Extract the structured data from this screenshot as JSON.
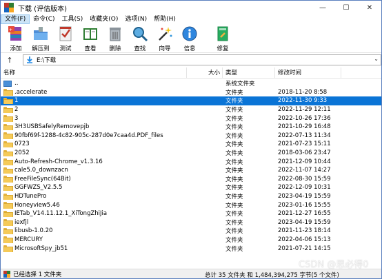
{
  "window": {
    "title": "下载 (评估版本)",
    "controls": {
      "minimize": "—",
      "maximize": "☐",
      "close": "✕"
    }
  },
  "menu": [
    {
      "label": "文件(F)",
      "active": true
    },
    {
      "label": "命令(C)"
    },
    {
      "label": "工具(S)"
    },
    {
      "label": "收藏夹(O)"
    },
    {
      "label": "选项(N)"
    },
    {
      "label": "帮助(H)"
    }
  ],
  "toolbar": [
    {
      "label": "添加",
      "icon": "add-icon"
    },
    {
      "label": "解压到",
      "icon": "extract-icon"
    },
    {
      "label": "测试",
      "icon": "test-icon"
    },
    {
      "label": "查看",
      "icon": "view-icon"
    },
    {
      "label": "删除",
      "icon": "delete-icon"
    },
    {
      "label": "查找",
      "icon": "find-icon"
    },
    {
      "label": "向导",
      "icon": "wizard-icon"
    },
    {
      "label": "信息",
      "icon": "info-icon"
    },
    {
      "label": "修复",
      "icon": "repair-icon"
    }
  ],
  "address": {
    "path": "E:\\下载"
  },
  "columns": {
    "name": "名称",
    "size": "大小",
    "type": "类型",
    "date": "修改时间"
  },
  "files": [
    {
      "name": "..",
      "size": "",
      "type": "系统文件夹",
      "date": "",
      "kind": "up"
    },
    {
      "name": ".accelerate",
      "size": "",
      "type": "文件夹",
      "date": "2018-11-20 8:58"
    },
    {
      "name": "1",
      "size": "",
      "type": "文件夹",
      "date": "2022-11-30 9:33",
      "selected": true
    },
    {
      "name": "2",
      "size": "",
      "type": "文件夹",
      "date": "2022-11-29 12:11"
    },
    {
      "name": "3",
      "size": "",
      "type": "文件夹",
      "date": "2022-10-26 17:36"
    },
    {
      "name": "3H3USBSafelyRemovepjb",
      "size": "",
      "type": "文件夹",
      "date": "2021-10-29 16:48"
    },
    {
      "name": "90fbf69f-1288-4c82-905c-287d0e7caa4d.PDF_files",
      "size": "",
      "type": "文件夹",
      "date": "2022-07-13 11:34"
    },
    {
      "name": "0723",
      "size": "",
      "type": "文件夹",
      "date": "2021-07-23 15:11"
    },
    {
      "name": "2052",
      "size": "",
      "type": "文件夹",
      "date": "2018-03-06 23:47"
    },
    {
      "name": "Auto-Refresh-Chrome_v1.3.16",
      "size": "",
      "type": "文件夹",
      "date": "2021-12-09 10:44"
    },
    {
      "name": "cale5.0_downzacn",
      "size": "",
      "type": "文件夹",
      "date": "2022-11-07 14:27"
    },
    {
      "name": "FreeFileSync(64Bit)",
      "size": "",
      "type": "文件夹",
      "date": "2022-08-30 15:59"
    },
    {
      "name": "GGFWZS_V2.5.5",
      "size": "",
      "type": "文件夹",
      "date": "2022-12-09 10:31"
    },
    {
      "name": "HDTunePro",
      "size": "",
      "type": "文件夹",
      "date": "2023-04-19 15:59"
    },
    {
      "name": "Honeyview5.46",
      "size": "",
      "type": "文件夹",
      "date": "2023-01-16 15:55"
    },
    {
      "name": "IETab_V14.11.12.1_XiTongZhiJia",
      "size": "",
      "type": "文件夹",
      "date": "2021-12-27 16:55"
    },
    {
      "name": "iexfjl",
      "size": "",
      "type": "文件夹",
      "date": "2023-04-19 15:59"
    },
    {
      "name": "libusb-1.0.20",
      "size": "",
      "type": "文件夹",
      "date": "2021-11-23 18:14"
    },
    {
      "name": "MERCURY",
      "size": "",
      "type": "文件夹",
      "date": "2022-04-06 15:13"
    },
    {
      "name": "MicrosoftSpy_jb51",
      "size": "",
      "type": "文件夹",
      "date": "2021-07-21 14:15"
    }
  ],
  "status": {
    "left": "已经选择 1 文件夹",
    "right": "总计 35 文件夹 和 1,484,394,275 字节(5 个文件)"
  },
  "watermark": "CSDN @思必得0"
}
